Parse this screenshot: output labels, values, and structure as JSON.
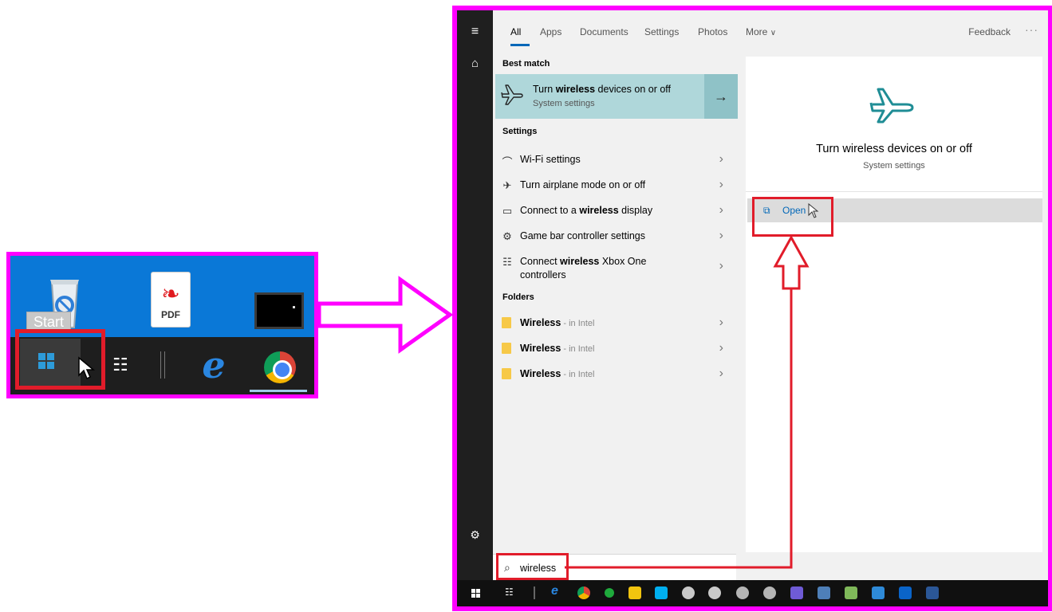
{
  "left_panel": {
    "start_tooltip": "Start",
    "pdf_label": "PDF",
    "desktop_icons": [
      "recycle-bin-icon",
      "pdf-icon",
      "video-file-icon"
    ],
    "taskbar_icons": [
      "windows-start-icon",
      "task-view-icon",
      "internet-explorer-icon",
      "chrome-icon"
    ]
  },
  "search_window": {
    "tabs": [
      {
        "label": "All"
      },
      {
        "label": "Apps"
      },
      {
        "label": "Documents"
      },
      {
        "label": "Settings"
      },
      {
        "label": "Photos"
      },
      {
        "label": "More"
      }
    ],
    "feedback_label": "Feedback",
    "more_dots": "···",
    "best_match": {
      "heading": "Best match",
      "title_prefix": "Turn ",
      "title_bold": "wireless",
      "title_suffix": " devices on or off",
      "subtitle": "System settings",
      "arrow": "→"
    },
    "settings": {
      "heading": "Settings",
      "items": [
        {
          "prefix": "Wi-Fi settings",
          "bold": "",
          "suffix": "",
          "icon": "wifi-icon"
        },
        {
          "prefix": "Turn airplane mode on or off",
          "bold": "",
          "suffix": "",
          "icon": "airplane-mode-icon"
        },
        {
          "prefix": "Connect to a ",
          "bold": "wireless",
          "suffix": " display",
          "icon": "display-icon"
        },
        {
          "prefix": "Game bar controller settings",
          "bold": "",
          "suffix": "",
          "icon": "gamebar-icon"
        },
        {
          "prefix": "Connect ",
          "bold": "wireless",
          "suffix": " Xbox One controllers",
          "icon": "xbox-icon"
        }
      ]
    },
    "folders": {
      "heading": "Folders",
      "items": [
        {
          "name": "Wireless",
          "location": " - in Intel"
        },
        {
          "name": "Wireless",
          "location": " - in Intel"
        },
        {
          "name": "Wireless",
          "location": " - in Intel"
        }
      ]
    },
    "preview": {
      "title": "Turn wireless devices on or off",
      "subtitle": "System settings",
      "open_label": "Open"
    },
    "search": {
      "query": "wireless"
    }
  },
  "colors": {
    "highlight_frame": "#ff00ff",
    "annotation_red": "#e11c2a",
    "best_match_bg": "#afd7da",
    "accent": "#0067b8",
    "plane_icon": "#1f8d95"
  }
}
